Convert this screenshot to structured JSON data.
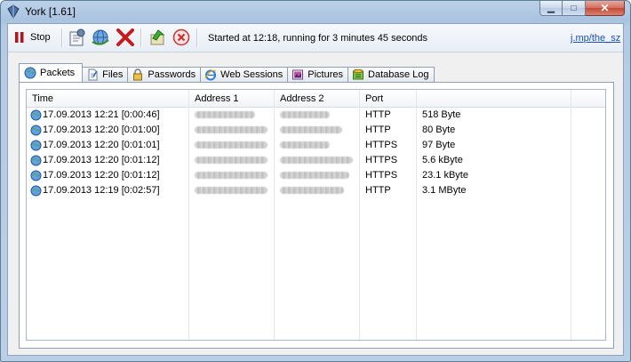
{
  "window": {
    "title": "York [1.61]"
  },
  "toolbar": {
    "stop_label": "Stop",
    "status": "Started at 12:18, running for 3 minutes 45 seconds",
    "link": "j.mp/the_sz"
  },
  "tabs": [
    {
      "label": "Packets",
      "icon": "globe-icon"
    },
    {
      "label": "Files",
      "icon": "file-icon"
    },
    {
      "label": "Passwords",
      "icon": "lock-icon"
    },
    {
      "label": "Web Sessions",
      "icon": "ie-icon"
    },
    {
      "label": "Pictures",
      "icon": "pictures-icon"
    },
    {
      "label": "Database Log",
      "icon": "database-icon"
    }
  ],
  "table": {
    "columns": [
      "Time",
      "Address 1",
      "Address 2",
      "Port",
      ""
    ],
    "rows": [
      {
        "time": "17.09.2013 12:21 [0:00:46]",
        "port": "HTTP",
        "size": "518 Byte"
      },
      {
        "time": "17.09.2013 12:20 [0:01:00]",
        "port": "HTTP",
        "size": "80 Byte"
      },
      {
        "time": "17.09.2013 12:20 [0:01:01]",
        "port": "HTTPS",
        "size": "97 Byte"
      },
      {
        "time": "17.09.2013 12:20 [0:01:12]",
        "port": "HTTPS",
        "size": "5.6 kByte"
      },
      {
        "time": "17.09.2013 12:20 [0:01:12]",
        "port": "HTTPS",
        "size": "23.1 kByte"
      },
      {
        "time": "17.09.2013 12:19 [0:02:57]",
        "port": "HTTP",
        "size": "3.1 MByte"
      }
    ]
  }
}
